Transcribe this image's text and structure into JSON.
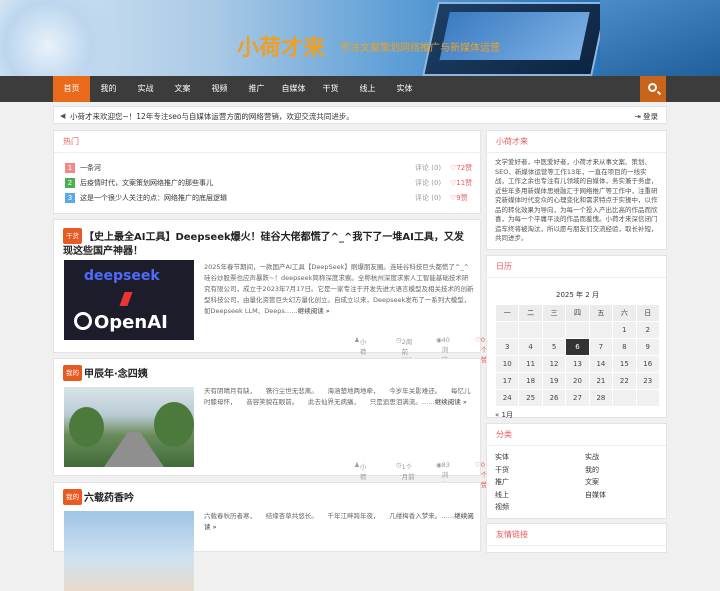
{
  "site": {
    "title": "小荷才来",
    "subtitle": "专注文案策划网络推广与新媒体运营"
  },
  "nav": {
    "items": [
      "首页",
      "我的",
      "实战",
      "文案",
      "视频",
      "推广",
      "自媒体",
      "干货",
      "线上",
      "实体"
    ],
    "active_index": 0,
    "search_icon": "search-icon"
  },
  "notice": {
    "text": "小荷才来欢迎您~！12年专注seo与自媒体运营方面的网络营销，欢迎交流共同进步。",
    "login": "登录"
  },
  "hot": {
    "title": "热门",
    "items": [
      {
        "num": "1",
        "title": "一条河",
        "comments": "评论 (0)",
        "likes": "♡72赞",
        "color": "#f08a8a"
      },
      {
        "num": "2",
        "title": "后疫情时代，文案策划网络推广的那些事儿",
        "comments": "评论 (0)",
        "likes": "♡11赞",
        "color": "#4caf50"
      },
      {
        "num": "3",
        "title": "这是一个很少人关注的点：网络推广的底层逻辑",
        "comments": "评论 (0)",
        "likes": "♡9赞",
        "color": "#5aa9e6"
      }
    ]
  },
  "posts": [
    {
      "tag": "干货",
      "title": "【史上最全AI工具】Deepseek爆火！硅谷大佬都慌了^_^我下了一堆AI工具，又发现这些国产神器！",
      "excerpt": "2025年春节期间，一款国产AI工具【DeepSeek】刷爆朋友圈。连硅谷科技巨头都慌了^_^硅谷炒股票也应声暴跌~！deepseek简称深度求索。全称杭州深度求索人工智能基础技术研究有限公司，成立于2023年7月17日。它是一家专注于开发先进大语言模型及相关技术的创新型科技公司，由量化资管巨头幻方量化创立。自成立以来，Deepseek发布了一系列大模型，如Deepseek LLM、Deeps……",
      "more": "继续阅读 »",
      "author": "小荷才来",
      "time": "2周前 (02-06)",
      "views": "40浏览",
      "likes": "0个赞",
      "thumb_text": {
        "a": "deepseek",
        "b": "OpenAI"
      }
    },
    {
      "tag": "我的",
      "title": "甲辰年·念四姨",
      "excerpt": "天有阴晴月有缺，　　镌行尘世无悲离。　　海涵楚地两地牵，　　今岁年关影难还。　　每忆儿时膝母怀，　　音容笑貌在眼前。　　此去仙界无病痛，　　只是追思泪满流。……",
      "more": "继续阅读 »",
      "author": "小荷才来",
      "time": "1个月前 (01-12)",
      "views": "83浏览",
      "likes": "0个赞"
    },
    {
      "tag": "我的",
      "title": "六载药香吟",
      "excerpt": "六载春秋历者寒，　　结缘杏草共悠长。　　千年江畔跨年夜，　　几缕梅香入梦来。……",
      "more": "继续阅读 »"
    }
  ],
  "sidebar": {
    "about_title": "小荷才来",
    "about_text": "文学爱好者，中医爱好者，小荷才来从事文案、策划、SEO、新媒体运营等工作13年，一直在项目的一线实战，工作之余也专注有儿领域的自媒体，务实兼于务虚，近些年多用新媒体思维融汇于网络推广等工作中，注重研究新媒体时代变众的心理变化和需求特点于实操中，以作品的转化效果为导向，为每一个投入产出比高的作品而欣喜，为每一个平庸平淡的作品而羞愧。小荷才来深信闭门造车终将被淘汰，所以愿与朋友们交流经验，取长补短，共同进步。",
    "calendar_title": "日历",
    "calendar": {
      "caption": "2025 年 2 月",
      "weekdays": [
        "一",
        "二",
        "三",
        "四",
        "五",
        "六",
        "日"
      ],
      "weeks": [
        [
          "",
          "",
          "",
          "",
          "",
          "1",
          "2"
        ],
        [
          "3",
          "4",
          "5",
          "6",
          "7",
          "8",
          "9"
        ],
        [
          "10",
          "11",
          "12",
          "13",
          "14",
          "15",
          "16"
        ],
        [
          "17",
          "18",
          "19",
          "20",
          "21",
          "22",
          "23"
        ],
        [
          "24",
          "25",
          "26",
          "27",
          "28",
          "",
          ""
        ]
      ],
      "today": "6",
      "prev": "« 1月"
    },
    "category_title": "分类",
    "categories": [
      "实体",
      "实战",
      "干货",
      "我的",
      "推广",
      "文案",
      "线上",
      "自媒体",
      "视频"
    ],
    "links_title": "友情链接"
  }
}
